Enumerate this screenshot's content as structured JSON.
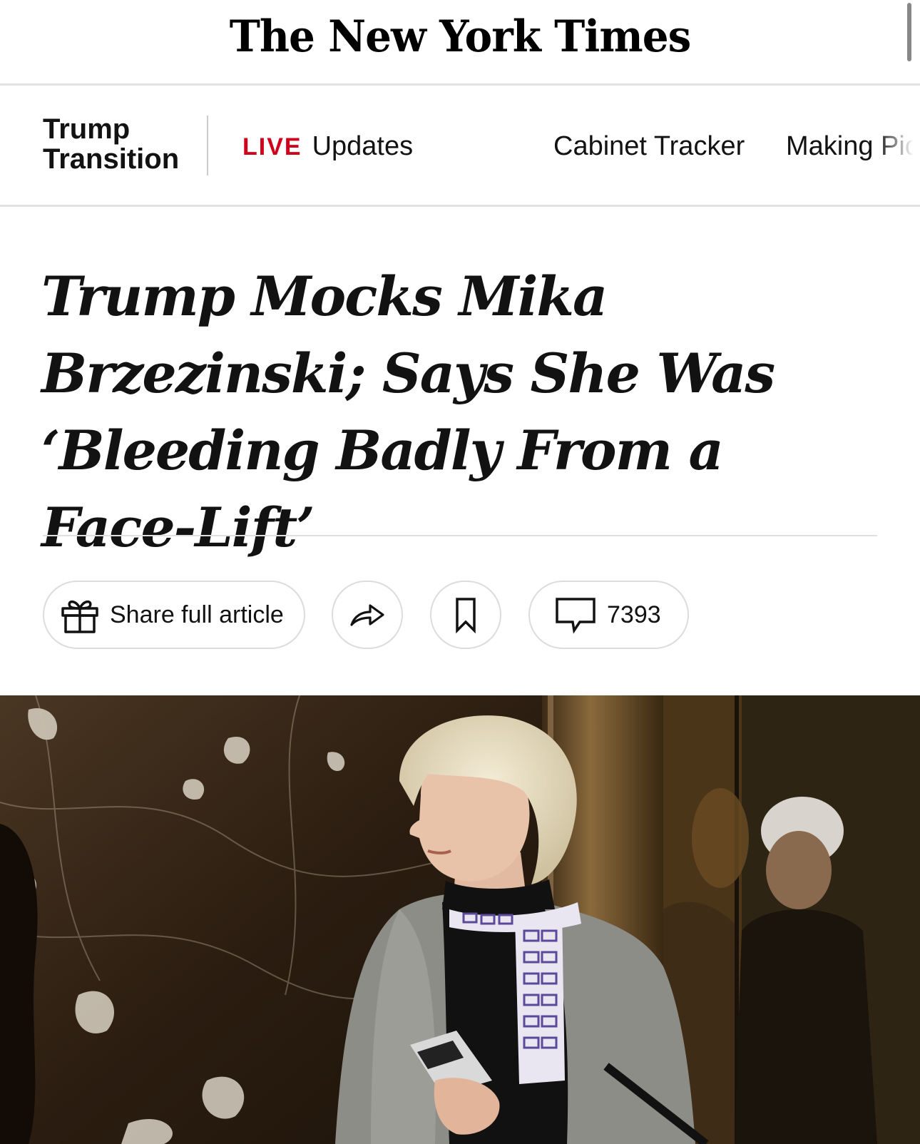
{
  "masthead": {
    "logo_text": "The New York Times"
  },
  "section_nav": {
    "section_title": "Trump Transition",
    "items": [
      {
        "badge": "LIVE",
        "label": "Updates"
      },
      {
        "label": "Cabinet Tracker"
      },
      {
        "label": "Making Pic"
      }
    ]
  },
  "article": {
    "headline": "Trump Mocks Mika Brzezinski; Says She Was ‘Bleeding Badly From a Face-Lift’"
  },
  "actions": {
    "share_label": "Share full article",
    "share_icon": "gift-icon",
    "forward_icon": "share-arrow-icon",
    "save_icon": "bookmark-icon",
    "comments_icon": "comment-bubble-icon",
    "comment_count": "7393"
  },
  "colors": {
    "live_red": "#d0021b",
    "text": "#121212",
    "border": "#dcdcdc"
  }
}
